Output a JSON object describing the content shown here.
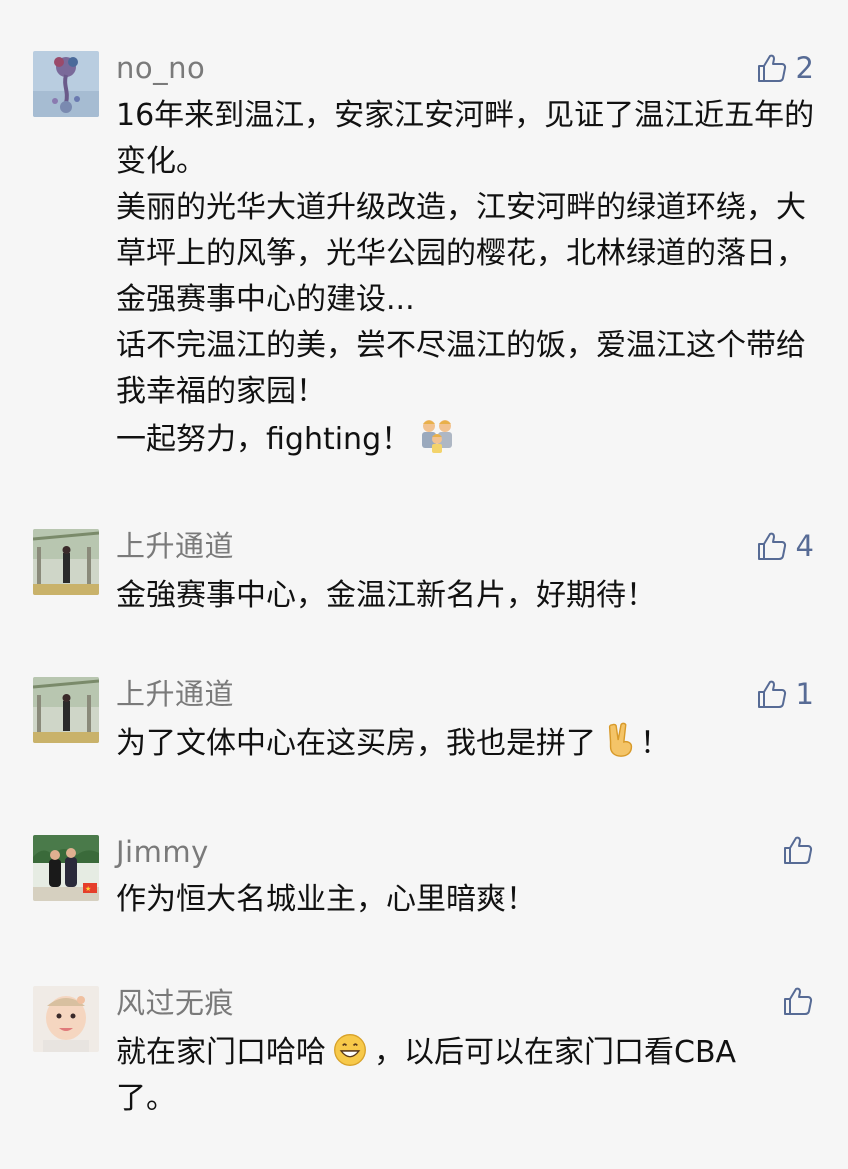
{
  "comments": [
    {
      "username": "no_no",
      "like_count": "2",
      "lines": [
        "16年来到温江，安家江安河畔，见证了温江近五年的变化。",
        "美丽的光华大道升级改造，江安河畔的绿道环绕，大草坪上的风筝，光华公园的樱花，北林绿道的落日，金强赛事中心的建设...",
        "话不完温江的美，尝不尽温江的饭，爱温江这个带给我幸福的家园！",
        "一起努力，fighting！"
      ],
      "trailing_emoji": "family-emoji"
    },
    {
      "username": "上升通道",
      "like_count": "4",
      "lines": [
        "金強赛事中心，金温江新名片，好期待！"
      ]
    },
    {
      "username": "上升通道",
      "like_count": "1",
      "lines": [
        "为了文体中心在这买房，我也是拼了"
      ],
      "inline_emoji": "victory-hand-emoji",
      "after_emoji": "！"
    },
    {
      "username": "Jimmy",
      "like_count": "",
      "lines": [
        "作为恒大名城业主，心里暗爽！"
      ]
    },
    {
      "username": "风过无痕",
      "like_count": "",
      "text_before_emoji": "就在家门口哈哈",
      "inline_emoji": "grinning-face-emoji",
      "text_after_emoji": "，以后可以在家门口看CBA了。"
    }
  ],
  "colors": {
    "background": "#f6f6f6",
    "username": "#7a7a7a",
    "like": "#576b95",
    "text": "#111111"
  },
  "icons": [
    "thumbs-up-icon"
  ]
}
